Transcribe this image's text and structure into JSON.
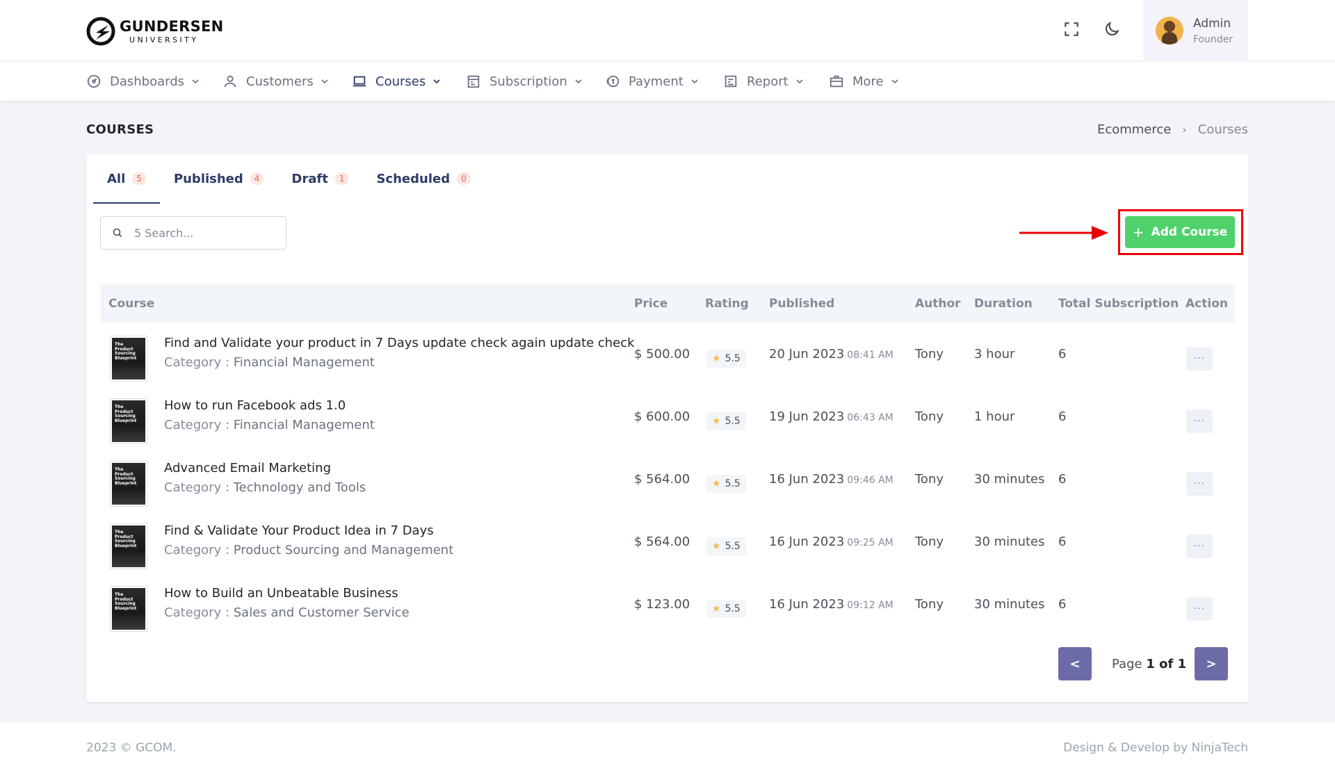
{
  "brand": {
    "name": "GUNDERSEN",
    "sub": "UNIVERSITY"
  },
  "header": {
    "fullscreen_icon": "fullscreen-icon",
    "theme_icon": "moon-icon"
  },
  "user": {
    "name": "Admin",
    "role": "Founder"
  },
  "nav": {
    "items": [
      {
        "label": "Dashboards",
        "icon": "dashboard-icon"
      },
      {
        "label": "Customers",
        "icon": "user-icon"
      },
      {
        "label": "Courses",
        "icon": "laptop-icon",
        "active": true
      },
      {
        "label": "Subscription",
        "icon": "calendar-icon"
      },
      {
        "label": "Payment",
        "icon": "coins-icon"
      },
      {
        "label": "Report",
        "icon": "report-icon"
      },
      {
        "label": "More",
        "icon": "briefcase-icon"
      }
    ]
  },
  "page": {
    "title": "COURSES",
    "breadcrumb": [
      "Ecommerce",
      "Courses"
    ]
  },
  "tabs": [
    {
      "label": "All",
      "count": "5"
    },
    {
      "label": "Published",
      "count": "4"
    },
    {
      "label": "Draft",
      "count": "1"
    },
    {
      "label": "Scheduled",
      "count": "0"
    }
  ],
  "search": {
    "placeholder": "5 Search..."
  },
  "add_button": {
    "label": "Add Course"
  },
  "table": {
    "headers": [
      "Course",
      "Price",
      "Rating",
      "Published",
      "Author",
      "Duration",
      "Total Subscription",
      "Action"
    ],
    "category_prefix": "Category : ",
    "rows": [
      {
        "title": "Find and Validate your product in 7 Days update check again update check",
        "category": "Financial Management",
        "price": "$ 500.00",
        "rating": "5.5",
        "date": "20 Jun 2023",
        "time": "08:41 AM",
        "author": "Tony",
        "duration": "3 hour",
        "subs": "6"
      },
      {
        "title": "How to run Facebook ads 1.0",
        "category": "Financial Management",
        "price": "$ 600.00",
        "rating": "5.5",
        "date": "19 Jun 2023",
        "time": "06:43 AM",
        "author": "Tony",
        "duration": "1 hour",
        "subs": "6"
      },
      {
        "title": "Advanced Email Marketing",
        "category": "Technology and Tools",
        "price": "$ 564.00",
        "rating": "5.5",
        "date": "16 Jun 2023",
        "time": "09:46 AM",
        "author": "Tony",
        "duration": "30 minutes",
        "subs": "6"
      },
      {
        "title": "Find & Validate Your Product Idea in 7 Days",
        "category": "Product Sourcing and Management",
        "price": "$ 564.00",
        "rating": "5.5",
        "date": "16 Jun 2023",
        "time": "09:25 AM",
        "author": "Tony",
        "duration": "30 minutes",
        "subs": "6"
      },
      {
        "title": "How to Build an Unbeatable Business",
        "category": "Sales and Customer Service",
        "price": "$ 123.00",
        "rating": "5.5",
        "date": "16 Jun 2023",
        "time": "09:12 AM",
        "author": "Tony",
        "duration": "30 minutes",
        "subs": "6"
      }
    ],
    "thumb_text": "The Product Sourcing Blueprint",
    "action_label": "···"
  },
  "pagination": {
    "prev": "<",
    "next": ">",
    "page_prefix": "Page ",
    "page_value": "1 of 1"
  },
  "footer": {
    "left": "2023 © GCOM.",
    "right": "Design & Develop by NinjaTech"
  },
  "colors": {
    "accent": "#2b3a67",
    "add_button": "#4fd16b",
    "annotation": "#ea0000",
    "pagination": "#6d6aa8"
  }
}
